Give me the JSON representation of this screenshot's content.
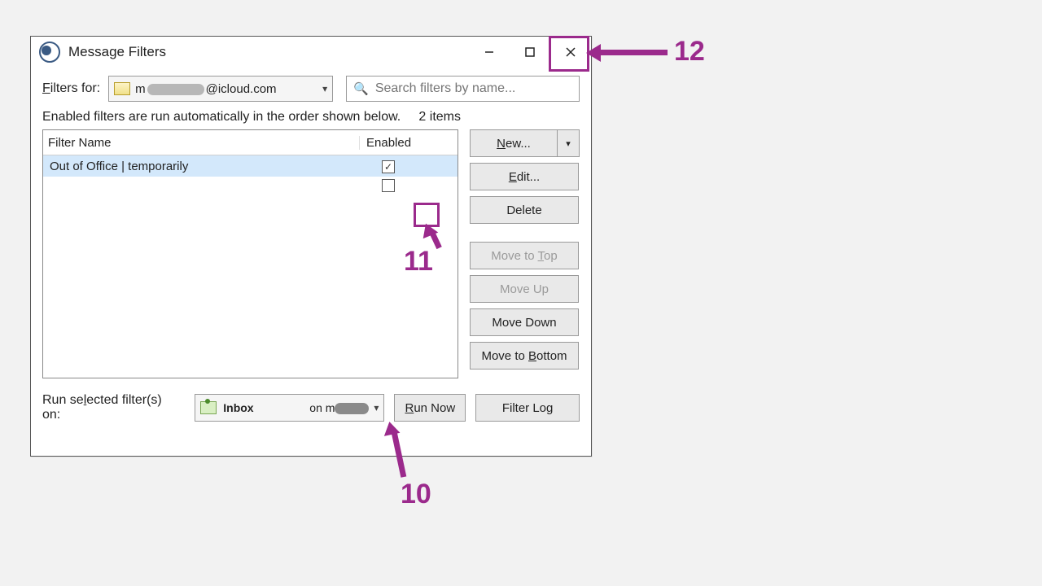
{
  "window": {
    "title": "Message Filters"
  },
  "filters_for_label": "Filters for:",
  "account": {
    "prefix": "m",
    "suffix": "@icloud.com"
  },
  "search": {
    "placeholder": "Search filters by name..."
  },
  "info_text": "Enabled filters are run automatically in the order shown below.",
  "item_count": "2 items",
  "columns": {
    "name": "Filter Name",
    "enabled": "Enabled"
  },
  "rows": [
    {
      "name": "Out of Office | temporarily",
      "enabled": true,
      "selected": true
    },
    {
      "name": "",
      "enabled": false,
      "selected": false
    }
  ],
  "buttons": {
    "new": "New...",
    "edit": "Edit...",
    "delete": "Delete",
    "move_top": "Move to Top",
    "move_up": "Move Up",
    "move_down": "Move Down",
    "move_bottom": "Move to Bottom",
    "run_now": "Run Now",
    "filter_log": "Filter Log"
  },
  "run_label": "Run selected filter(s) on:",
  "folder": {
    "name": "Inbox",
    "on": "on m"
  },
  "annotations": {
    "a10": "10",
    "a11": "11",
    "a12": "12"
  },
  "accent_color": "#9b2a8c"
}
